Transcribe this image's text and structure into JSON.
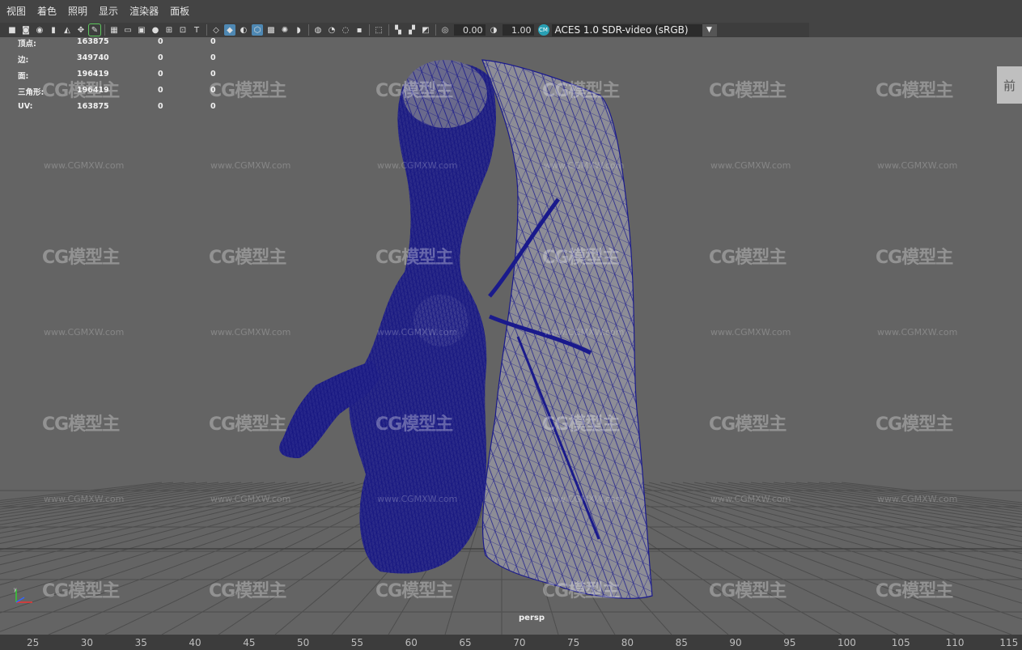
{
  "menu": [
    "视图",
    "着色",
    "照明",
    "显示",
    "渲染器",
    "面板"
  ],
  "toolbar": {
    "exposure": "0.00",
    "gamma": "1.00",
    "colorspace": "ACES 1.0 SDR-video (sRGB)"
  },
  "hud": {
    "rows": [
      {
        "label": "顶点:",
        "v1": "163875",
        "v2": "0",
        "v3": "0"
      },
      {
        "label": "边:",
        "v1": "349740",
        "v2": "0",
        "v3": "0"
      },
      {
        "label": "面:",
        "v1": "196419",
        "v2": "0",
        "v3": "0"
      },
      {
        "label": "三角形:",
        "v1": "196419",
        "v2": "0",
        "v3": "0"
      },
      {
        "label": "UV:",
        "v1": "163875",
        "v2": "0",
        "v3": "0"
      }
    ]
  },
  "viewcube_label": "前",
  "camera_label": "persp",
  "watermark": {
    "logo": "CG模型主",
    "url": "www.CGMXW.com"
  },
  "timeline": {
    "ticks": [
      "25",
      "30",
      "35",
      "40",
      "45",
      "50",
      "55",
      "60",
      "65",
      "70",
      "75",
      "80",
      "85",
      "90",
      "95",
      "100",
      "105",
      "110",
      "115"
    ]
  },
  "colors": {
    "wire": "#1a1a8c",
    "viewport_bg": "#646464",
    "grid": "#4a4a4a",
    "accent": "#4e88b3"
  }
}
